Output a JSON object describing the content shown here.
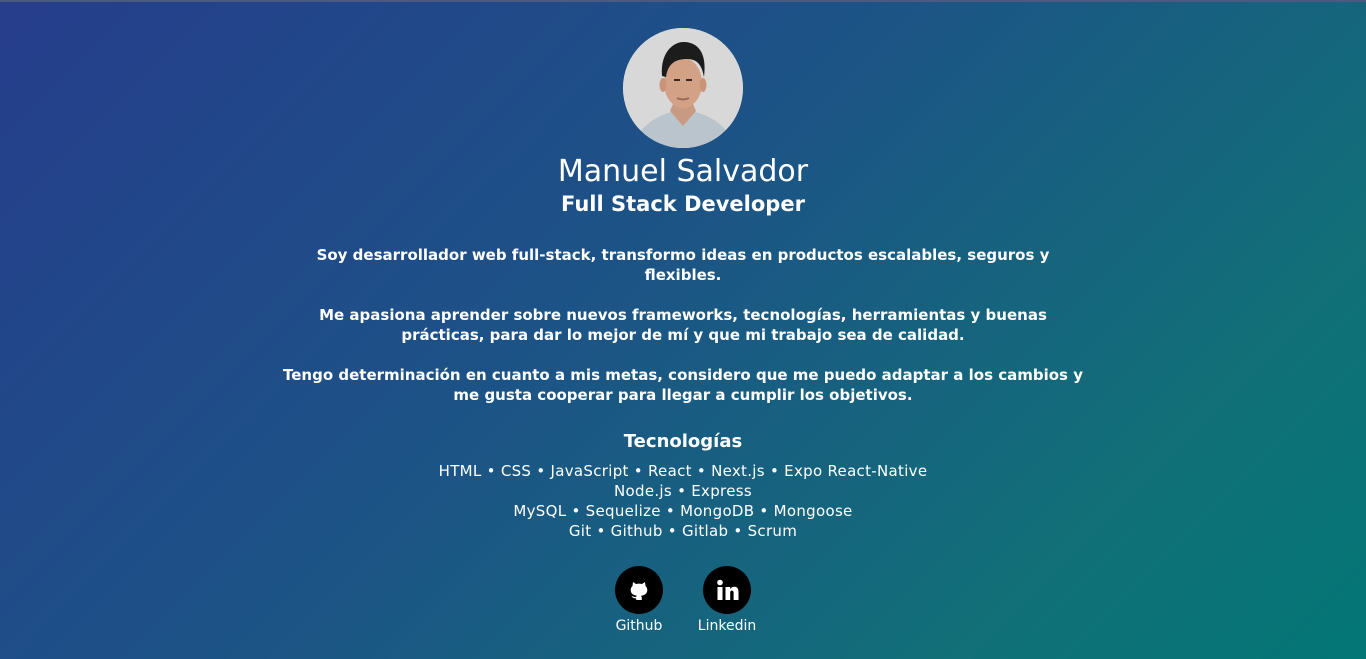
{
  "profile": {
    "avatar_alt": "Manuel Salvador",
    "name": "Manuel Salvador",
    "role": "Full Stack Developer"
  },
  "bio": [
    "Soy desarrollador web full-stack, transformo ideas en productos escalables, seguros y flexibles.",
    "Me apasiona aprender sobre nuevos frameworks, tecnologías, herramientas y buenas prácticas, para dar lo mejor de mí y que mi trabajo sea de calidad.",
    "Tengo determinación en cuanto a mis metas, considero que me puedo adaptar a los cambios y me gusta cooperar para llegar a cumplir los objetivos."
  ],
  "technologies": {
    "title": "Tecnologías",
    "lines": [
      "HTML • CSS • JavaScript • React • Next.js • Expo React-Native",
      "Node.js • Express",
      "MySQL • Sequelize • MongoDB • Mongoose",
      "Git • Github • Gitlab • Scrum"
    ]
  },
  "social": [
    {
      "label": "Github",
      "icon": "github-icon"
    },
    {
      "label": "Linkedin",
      "icon": "linkedin-icon"
    }
  ],
  "colors": {
    "gradient_start": "#263d8c",
    "gradient_end": "#037676",
    "icon_circle": "#000000"
  }
}
